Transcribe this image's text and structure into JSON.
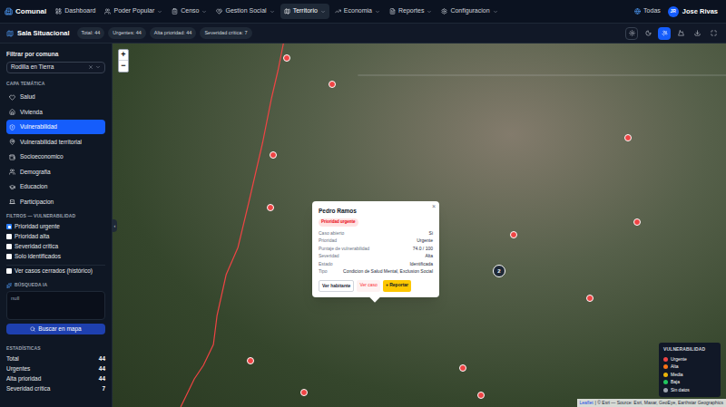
{
  "app": {
    "name": "Comunal"
  },
  "nav": [
    {
      "label": "Dashboard",
      "selected": false,
      "dropdown": false
    },
    {
      "label": "Poder Popular",
      "selected": false,
      "dropdown": true
    },
    {
      "label": "Censo",
      "selected": false,
      "dropdown": true
    },
    {
      "label": "Gestion Social",
      "selected": false,
      "dropdown": true
    },
    {
      "label": "Territorio",
      "selected": true,
      "dropdown": true
    },
    {
      "label": "Economia",
      "selected": false,
      "dropdown": true
    },
    {
      "label": "Reportes",
      "selected": false,
      "dropdown": true
    },
    {
      "label": "Configuracion",
      "selected": false,
      "dropdown": true
    }
  ],
  "scope": "Todas",
  "user": {
    "initials": "JR",
    "name": "Jose Rivas"
  },
  "toolbar": {
    "title": "Sala Situacional",
    "badges": [
      "Total: 44",
      "Urgentes: 44",
      "Alta prioridad: 44",
      "Severidad crítica: 7"
    ],
    "buttons": [
      {
        "selected": false
      },
      {
        "selected": false
      },
      {
        "selected": true
      },
      {
        "selected": false
      },
      {
        "selected": false
      },
      {
        "selected": false
      }
    ]
  },
  "sidebar": {
    "filter_label": "Filtrar por comuna",
    "comuna": "Rodilla en Tierra",
    "layers_heading": "CAPA TEMÁTICA",
    "layers": [
      {
        "label": "Salud",
        "selected": false
      },
      {
        "label": "Vivienda",
        "selected": false
      },
      {
        "label": "Vulnerabilidad",
        "selected": true
      },
      {
        "label": "Vulnerabilidad territorial",
        "selected": false
      },
      {
        "label": "Socioeconomico",
        "selected": false
      },
      {
        "label": "Demografia",
        "selected": false
      },
      {
        "label": "Educacion",
        "selected": false
      },
      {
        "label": "Participacion",
        "selected": false
      }
    ],
    "filters_heading": "FILTROS — VULNERABILIDAD",
    "filters": [
      {
        "label": "Prioridad urgente",
        "checked": true
      },
      {
        "label": "Prioridad alta",
        "checked": false
      },
      {
        "label": "Severidad critica",
        "checked": false
      },
      {
        "label": "Solo identificados",
        "checked": false
      }
    ],
    "history": {
      "label": "Ver casos cerrados (histórico)",
      "checked": false
    },
    "search_heading": "BÚSQUEDA IA",
    "search_value": "null",
    "search_button": "Buscar en mapa",
    "stats_heading": "ESTADÍSTICAS",
    "stats": [
      {
        "label": "Total",
        "value": "44"
      },
      {
        "label": "Urgentes",
        "value": "44"
      },
      {
        "label": "Alta prioridad",
        "value": "44"
      },
      {
        "label": "Severidad crítica",
        "value": "7"
      }
    ],
    "collapse": "‹"
  },
  "map": {
    "zoom_in": "+",
    "zoom_out": "−",
    "markers": [
      {
        "color": "#ef4444"
      },
      {
        "color": "#ef4444"
      },
      {
        "color": "#ef4444"
      },
      {
        "color": "#ef4444"
      },
      {
        "color": "#ef4444"
      },
      {
        "color": "#ef4444"
      },
      {
        "color": "#ef4444"
      },
      {
        "color": "#ef4444"
      },
      {
        "color": "#ef4444"
      },
      {
        "color": "#ef4444"
      },
      {
        "color": "#ef4444"
      },
      {
        "color": "#ef4444"
      },
      {
        "color": "#ef4444"
      }
    ],
    "cluster": {
      "count": "2"
    },
    "popup": {
      "close": "×",
      "title": "Pedro Ramos",
      "badge": "Prioridad urgente",
      "rows": [
        {
          "label": "Caso abierto",
          "value": "Si"
        },
        {
          "label": "Prioridad",
          "value": "Urgente"
        },
        {
          "label": "Puntaje de vulnerabilidad",
          "value": "74.0 / 100"
        },
        {
          "label": "Severidad",
          "value": "Alta"
        },
        {
          "label": "Estado",
          "value": "Identificada"
        },
        {
          "label": "Tipo",
          "value": "Condicion de Salud Mental, Exclusion Social"
        }
      ],
      "buttons": [
        "Ver habitante",
        "Ver caso",
        "+ Reportar"
      ]
    },
    "legend": {
      "title": "VULNERABILIDAD",
      "items": [
        {
          "label": "Urgente",
          "color": "#ef4444"
        },
        {
          "label": "Alta",
          "color": "#f97316"
        },
        {
          "label": "Media",
          "color": "#eab308"
        },
        {
          "label": "Baja",
          "color": "#22c55e"
        },
        {
          "label": "Sin datos",
          "color": "#9ca3af"
        }
      ]
    },
    "attribution": {
      "link": "Leaflet",
      "text": "| © Esri — Source: Esri, Maxar, GeoEye, Earthstar Geographics"
    }
  }
}
